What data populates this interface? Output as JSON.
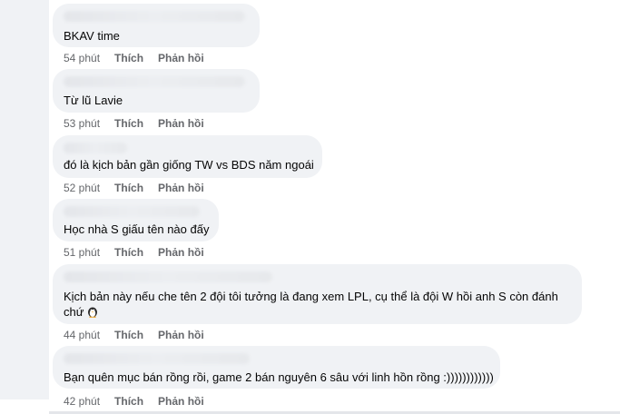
{
  "comments": [
    {
      "text": "BKAV time",
      "time": "54 phút",
      "like": "Thích",
      "reply": "Phản hồi"
    },
    {
      "text": "Từ lũ Lavie",
      "time": "53 phút",
      "like": "Thích",
      "reply": "Phản hồi"
    },
    {
      "text": "đó là kịch bản gần giống TW vs BDS năm ngoái",
      "time": "52 phút",
      "like": "Thích",
      "reply": "Phản hồi"
    },
    {
      "text": "Học nhà S giấu tên nào đấy",
      "time": "51 phút",
      "like": "Thích",
      "reply": "Phản hồi"
    },
    {
      "text": "Kịch bản này nếu che tên 2 đội tôi tưởng là đang xem LPL, cụ thể là đội W hồi anh S còn đánh chứ",
      "emoji": "penguin-emoji",
      "time": "44 phút",
      "like": "Thích",
      "reply": "Phản hồi"
    },
    {
      "text": "Bạn quên mục bán rồng rồi, game 2 bán nguyên 6 sâu với linh hồn rồng :))))))))))))",
      "time": "42 phút",
      "like": "Thích",
      "reply": "Phản hồi"
    }
  ],
  "colors": {
    "bubble": "#f0f2f5",
    "text": "#050505",
    "meta": "#65676b"
  }
}
